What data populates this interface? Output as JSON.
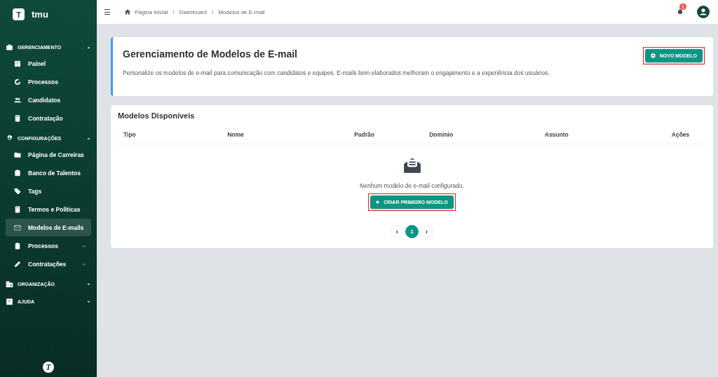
{
  "sidebar": {
    "brand": {
      "letter": "T",
      "name": "tmu"
    },
    "sections": [
      {
        "title": "GERENCIAMENTO",
        "expanded": true,
        "items": [
          {
            "label": "Painel",
            "selected": false
          },
          {
            "label": "Processos",
            "selected": false
          },
          {
            "label": "Candidatos",
            "selected": false
          },
          {
            "label": "Contratação",
            "selected": false
          }
        ]
      },
      {
        "title": "CONFIGURAÇÕES",
        "expanded": true,
        "items": [
          {
            "label": "Página de Carreiras",
            "selected": false
          },
          {
            "label": "Banco de Talentos",
            "selected": false
          },
          {
            "label": "Tags",
            "selected": false
          },
          {
            "label": "Termos e Políticas",
            "selected": false
          },
          {
            "label": "Modelos de E-mails",
            "selected": true
          },
          {
            "label": "Processos",
            "selected": false,
            "expanded": false
          },
          {
            "label": "Contratações",
            "selected": false,
            "expanded": false
          }
        ]
      },
      {
        "title": "ORGANIZAÇÃO",
        "expanded": false
      },
      {
        "title": "AJUDA",
        "expanded": false
      }
    ],
    "footer_logo": "T"
  },
  "topbar": {
    "menu_glyph": "☰",
    "breadcrumb": [
      "Página Inicial",
      "Dashboard",
      "Modelos de E-mail"
    ],
    "breadcrumb_separator": "/",
    "notification_count": "1"
  },
  "header_card": {
    "title": "Gerenciamento de Modelos de E-mail",
    "description": "Personalize os modelos de e-mail para comunicação com candidatos e equipes. E-mails bem elaborados melhoram o engajamento e a experiência dos usuários.",
    "button": {
      "label": "NOVO MODELO",
      "highlighted": true
    }
  },
  "templates_card": {
    "title": "Modelos Disponíveis",
    "table": {
      "columns": [
        "Tipo",
        "Nome",
        "Padrão",
        "Domínio",
        "Assunto",
        "Ações"
      ]
    },
    "empty_message": "Nenhum modelo de e-mail configurado.",
    "button": {
      "label": "CRIAR PRIMEIRO MODELO",
      "highlighted": true
    },
    "pagination": {
      "prev": "‹",
      "next": "›",
      "pages": [
        {
          "label": "1",
          "selected": true
        }
      ]
    }
  }
}
